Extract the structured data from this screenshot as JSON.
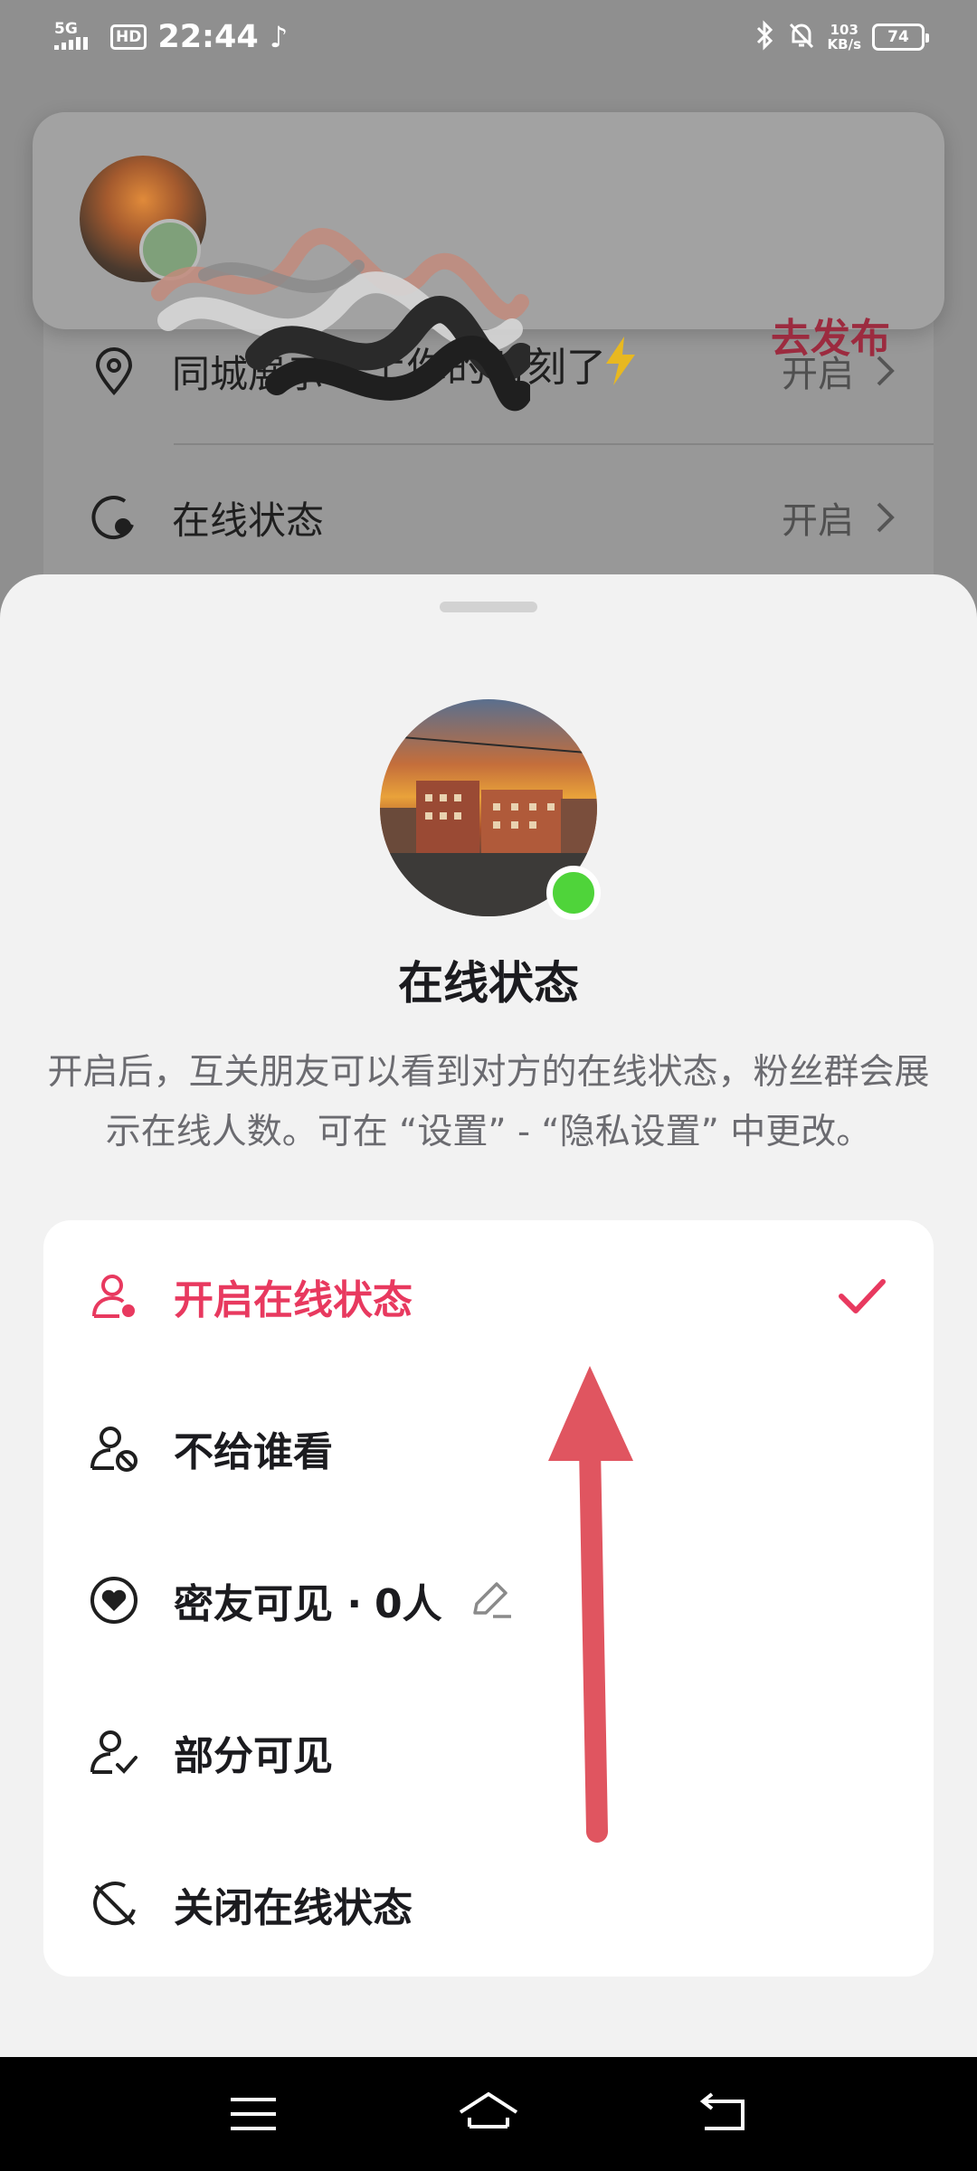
{
  "status_bar": {
    "network": "5G",
    "hd": "HD",
    "time": "22:44",
    "net_speed_value": "103",
    "net_speed_unit": "KB/s",
    "battery": "74"
  },
  "banner": {
    "text": "上你的时刻了",
    "action": "去发布"
  },
  "settings": {
    "rows": [
      {
        "label": "同城展示",
        "value": "开启"
      },
      {
        "label": "在线状态",
        "value": "开启"
      }
    ]
  },
  "sheet": {
    "title": "在线状态",
    "description": "开启后，互关朋友可以看到对方的在线状态，粉丝群会展示在线人数。可在 “设置” - “隐私设置” 中更改。",
    "options": [
      {
        "label": "开启在线状态",
        "selected": true
      },
      {
        "label": "不给谁看",
        "selected": false
      },
      {
        "label": "密友可见 ·",
        "count": "0人",
        "selected": false
      },
      {
        "label": "部分可见",
        "selected": false
      },
      {
        "label": "关闭在线状态",
        "selected": false
      }
    ]
  },
  "colors": {
    "accent": "#e8395f",
    "online": "#4fd43a",
    "annotation_arrow": "#e05560",
    "publish_action": "#9c2b3f"
  }
}
